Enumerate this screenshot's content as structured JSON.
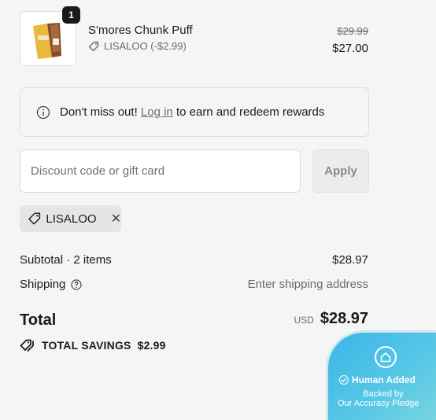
{
  "product": {
    "quantity": "1",
    "name": "S'mores Chunk Puff",
    "discount_line": "LISALOO (-$2.99)",
    "price_original": "$29.99",
    "price_final": "$27.00",
    "image_icon": "smores-product-image"
  },
  "rewards": {
    "prefix": "Don't miss out!",
    "link": "Log in",
    "suffix": "to earn and redeem rewards"
  },
  "discount": {
    "placeholder": "Discount code or gift card",
    "value": "",
    "apply_label": "Apply",
    "applied_code": "LISALOO"
  },
  "summary": {
    "subtotal_label": "Subtotal · 2 items",
    "subtotal_value": "$28.97",
    "shipping_label": "Shipping",
    "shipping_value": "Enter shipping address",
    "total_label": "Total",
    "currency": "USD",
    "total_value": "$28.97",
    "savings_label": "TOTAL SAVINGS",
    "savings_value": "$2.99"
  },
  "badge": {
    "title": "Human Added",
    "line1": "Backed by",
    "line2": "Our Accuracy Pledge"
  },
  "colors": {
    "accent_badge": "#3ab6e8",
    "text_muted": "#6b6b6b",
    "chip_bg": "#e5e5e5"
  }
}
